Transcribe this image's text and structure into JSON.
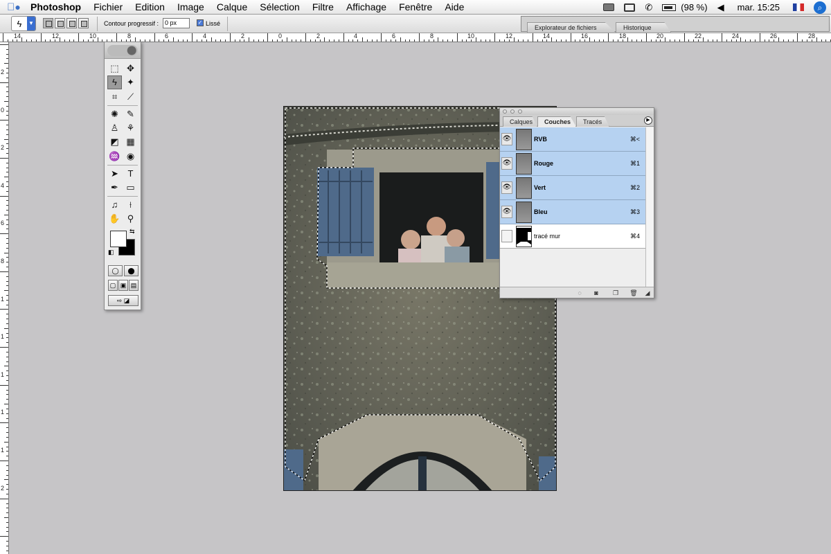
{
  "menubar": {
    "apple_icon": "",
    "app_name": "Photoshop",
    "items": [
      "Fichier",
      "Edition",
      "Image",
      "Calque",
      "Sélection",
      "Filtre",
      "Affichage",
      "Fenêtre",
      "Aide"
    ],
    "status": {
      "battery_percent": "(98 %)",
      "clock": "mar. 15:25"
    }
  },
  "options": {
    "feather_label": "Contour progressif :",
    "feather_value": "0 px",
    "antialias_label": "Lissé",
    "antialias_checked": true
  },
  "palette_well": {
    "tabs": [
      "Explorateur de fichiers",
      "Historique"
    ]
  },
  "rulers": {
    "top": [
      "14",
      "12",
      "10",
      "8",
      "6",
      "4",
      "2",
      "0",
      "2",
      "4",
      "6",
      "8",
      "10",
      "12",
      "14",
      "16",
      "18",
      "20",
      "22",
      "24",
      "26",
      "28"
    ],
    "left": [
      "2",
      "0",
      "2",
      "4",
      "6",
      "8",
      "1",
      "1",
      "1",
      "1",
      "1",
      "2"
    ]
  },
  "channels_palette": {
    "tabs": [
      "Calques",
      "Couches",
      "Tracés"
    ],
    "active_tab": "Couches",
    "channels": [
      {
        "name": "RVB",
        "shortcut": "⌘<",
        "visible": true,
        "selected": true
      },
      {
        "name": "Rouge",
        "shortcut": "⌘1",
        "visible": true,
        "selected": true
      },
      {
        "name": "Vert",
        "shortcut": "⌘2",
        "visible": true,
        "selected": true
      },
      {
        "name": "Bleu",
        "shortcut": "⌘3",
        "visible": true,
        "selected": true
      },
      {
        "name": "tracé mur",
        "shortcut": "⌘4",
        "visible": false,
        "selected": false
      }
    ],
    "selection_color": "#b6d2f1"
  },
  "colors": {
    "canvas_bg": "#c6c5c7",
    "shutter_blue": "#4f6a8a"
  }
}
